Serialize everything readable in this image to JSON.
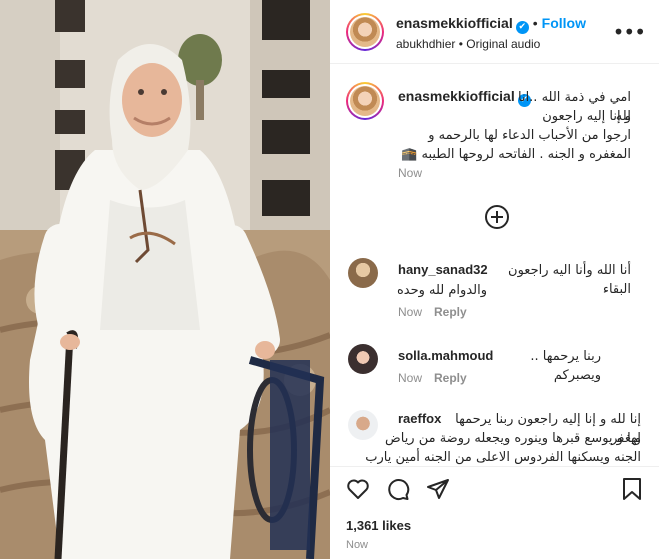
{
  "post": {
    "username": "enasmekkiofficial",
    "verified_mark": "✔",
    "separator": "•",
    "follow_label": "Follow",
    "audio_user": "abukhdhier",
    "audio_separator": "•",
    "audio_label": "Original audio",
    "more_icon": "•••"
  },
  "caption": {
    "username": "enasmekkiofficial",
    "lines": [
      "امي في ذمة الله ..انا لله",
      "و إنا إليه راجعون",
      "ارجوا من الأحباب الدعاء لها بالرحمه و",
      "المغفره و الجنه . الفاتحه لروحها الطيبه 🕋"
    ],
    "time": "Now"
  },
  "load_more_icon": "plus-circle-icon",
  "comments": [
    {
      "username": "hany_sanad32",
      "text_inline": "أنا الله وأنا اليه راجعون البقاء",
      "text_lines": [
        "والدوام لله وحده"
      ],
      "time": "Now",
      "reply": "Reply"
    },
    {
      "username": "solla.mahmoud",
      "text_inline": "ربنا يرحمها .. ويصبركم",
      "text_lines": [],
      "time": "Now",
      "reply": "Reply"
    },
    {
      "username": "raeffox",
      "text_inline": "إنا لله و إنا إليه راجعون ربنا يرحمها ويغفر",
      "text_lines": [
        "لها و يوسع قبرها وينوره ويجعله روضة من رياض",
        "الجنه ويسكنها الفردوس الاعلى من الجنه أمين يارب"
      ],
      "time": "Now",
      "reply": "Reply"
    }
  ],
  "actions": {
    "likes": "1,361 likes",
    "time": "Now"
  },
  "colors": {
    "accent": "#0095f6",
    "text": "#262626",
    "muted": "#8e8e8e",
    "border": "#efefef"
  }
}
